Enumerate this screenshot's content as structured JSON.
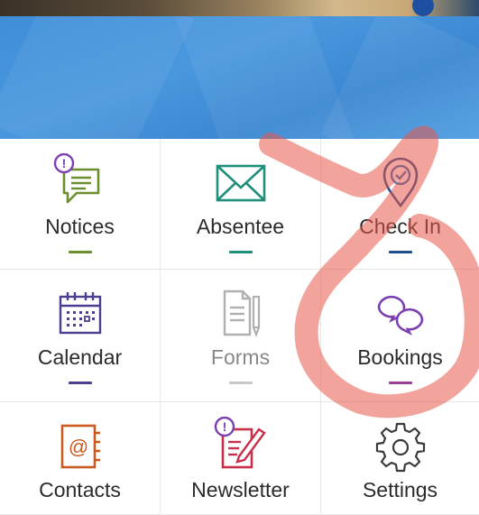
{
  "menu": {
    "items": [
      {
        "label": "Notices",
        "icon": "notices-icon",
        "color": "#6b8f2f",
        "badge": "!"
      },
      {
        "label": "Absentee",
        "icon": "envelope-icon",
        "color": "#1f8f7c"
      },
      {
        "label": "Check In",
        "icon": "location-pin-check-icon",
        "color": "#1f4f8f"
      },
      {
        "label": "Calendar",
        "icon": "calendar-icon",
        "color": "#4b3f8f"
      },
      {
        "label": "Forms",
        "icon": "forms-icon",
        "color": "#b0b0b0",
        "disabled": true
      },
      {
        "label": "Bookings",
        "icon": "chat-bubbles-icon",
        "color": "#7b3fb0"
      },
      {
        "label": "Contacts",
        "icon": "address-book-icon",
        "color": "#c85a1f"
      },
      {
        "label": "Newsletter",
        "icon": "newsletter-icon",
        "color": "#c82f4a",
        "badge": "!"
      },
      {
        "label": "Settings",
        "icon": "gear-icon",
        "color": "#3a3a3a"
      }
    ]
  },
  "colors": {
    "banner": "#4490da",
    "annotation": "#e8584a"
  }
}
